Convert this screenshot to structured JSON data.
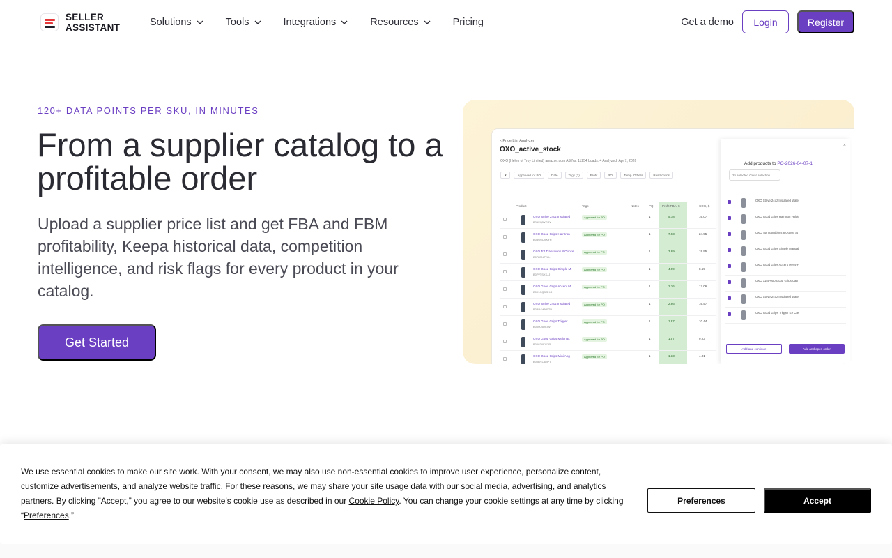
{
  "header": {
    "logo_line1": "SELLER",
    "logo_line2": "ASSISTANT",
    "nav": [
      {
        "label": "Solutions"
      },
      {
        "label": "Tools"
      },
      {
        "label": "Integrations"
      },
      {
        "label": "Resources"
      },
      {
        "label": "Pricing"
      }
    ],
    "demo_label": "Get a demo",
    "login_label": "Login",
    "register_label": "Register"
  },
  "hero": {
    "eyebrow": "120+ DATA POINTS PER SKU, IN MINUTES",
    "title": "From a supplier catalog to a profitable order",
    "subtitle": "Upload a supplier price list and get FBA and FBM profitability, Keepa historical data, competition intelligence, and risk flags for every product in your catalog.",
    "cta_label": "Get Started"
  },
  "screenshot": {
    "breadcrumb": "‹ Price List Analyzer",
    "title": "OXO_active_stock",
    "meta": "OXO (Helen of Troy Limited)   amazon.com   ASINs: 11254   Loads: 4   Analyzed: Apr 7, 2026",
    "filters": [
      "Approved for PO",
      "Date",
      "Tags (1)",
      "Profit",
      "ROI",
      "Temp. Others",
      "Restrictions"
    ],
    "columns": [
      "Product",
      "Tags",
      "Notes",
      "PQ",
      "Profit FBA, $",
      "COG, $"
    ],
    "rows": [
      {
        "name": "OXO Strive 24oz Insulated",
        "asin": "B09SQ5XG3X",
        "tag": "Approved for PO",
        "pq": "1",
        "profit": "5.78",
        "cog": "16.07"
      },
      {
        "name": "OXO Good Grips Hair Iron",
        "asin": "B08WNJVKYR",
        "tag": "Approved for PO",
        "pq": "1",
        "profit": "7.03",
        "cog": "24.95"
      },
      {
        "name": "OXO Tot Transitions 8 Ounce",
        "asin": "B07LBNTV6L",
        "tag": "Approved for PO",
        "pq": "1",
        "profit": "3.89",
        "cog": "19.95"
      },
      {
        "name": "OXO Good Grips Simple M.",
        "asin": "B07VTSXKJJ",
        "tag": "Approved for PO",
        "pq": "1",
        "profit": "4.09",
        "cog": "8.69"
      },
      {
        "name": "OXO Good Grips Accent M.",
        "asin": "B001CQDGHG",
        "tag": "Approved for PO",
        "pq": "1",
        "profit": "2.76",
        "cog": "17.06"
      },
      {
        "name": "OXO Strive 24oz Insulated",
        "asin": "B0BB4WNRTB",
        "tag": "Approved for PO",
        "pq": "1",
        "profit": "2.86",
        "cog": "16.57"
      },
      {
        "name": "OXO Good Grips Trigger",
        "asin": "B00004OCIW",
        "tag": "Approved for PO",
        "pq": "1",
        "profit": "1.97",
        "cog": "10.44"
      },
      {
        "name": "OXO Good Grips Melon B.",
        "asin": "B0002YKG2R",
        "tag": "Approved for PO",
        "pq": "1",
        "profit": "1.57",
        "cog": "9.23"
      },
      {
        "name": "OXO Good Grips Mini Ang",
        "asin": "B00BYLAMPT",
        "tag": "Approved for PO",
        "pq": "1",
        "profit": "1.33",
        "cog": "4.01"
      }
    ],
    "panel": {
      "title_prefix": "Add products to",
      "title_po": "PO-2026-04-07-1",
      "selected": "25 selected  Clear selection",
      "items": [
        "OXO Strive 24oz Insulated Wate",
        "OXO Good Grips Hair Iron Holde",
        "OXO Tot Transitions 8 Ounce St",
        "OXO Good Grips Simple Manual",
        "OXO Good Grips Accent Mess-F",
        "OXO 1155-000 Good Grips Can",
        "OXO Strive 24oz Insulated Wate",
        "OXO Good Grips Trigger Ice Cre"
      ],
      "btn_add": "Add and continue",
      "btn_add_open": "Add and open order"
    }
  },
  "cookie": {
    "text_part1": "We use essential cookies to make our site work. With your consent, we may also use non-essential cookies to improve user experience, personalize content, customize advertisements, and analyze website traffic. For these reasons, we may share your site usage data with our social media, advertising, and analytics partners. By clicking ”Accept,” you agree to our website's cookie use as described in our ",
    "policy_link": "Cookie Policy",
    "text_part2": ". You can change your cookie settings at any time by clicking “",
    "pref_link": "Preferences",
    "text_part3": ".”",
    "preferences_label": "Preferences",
    "accept_label": "Accept"
  },
  "colors": {
    "brand": "#6b3fc2",
    "accept": "#000000",
    "logo_red": "#e5383b"
  },
  "icons": [
    "chevron-down-icon",
    "close-icon",
    "filter-icon"
  ]
}
